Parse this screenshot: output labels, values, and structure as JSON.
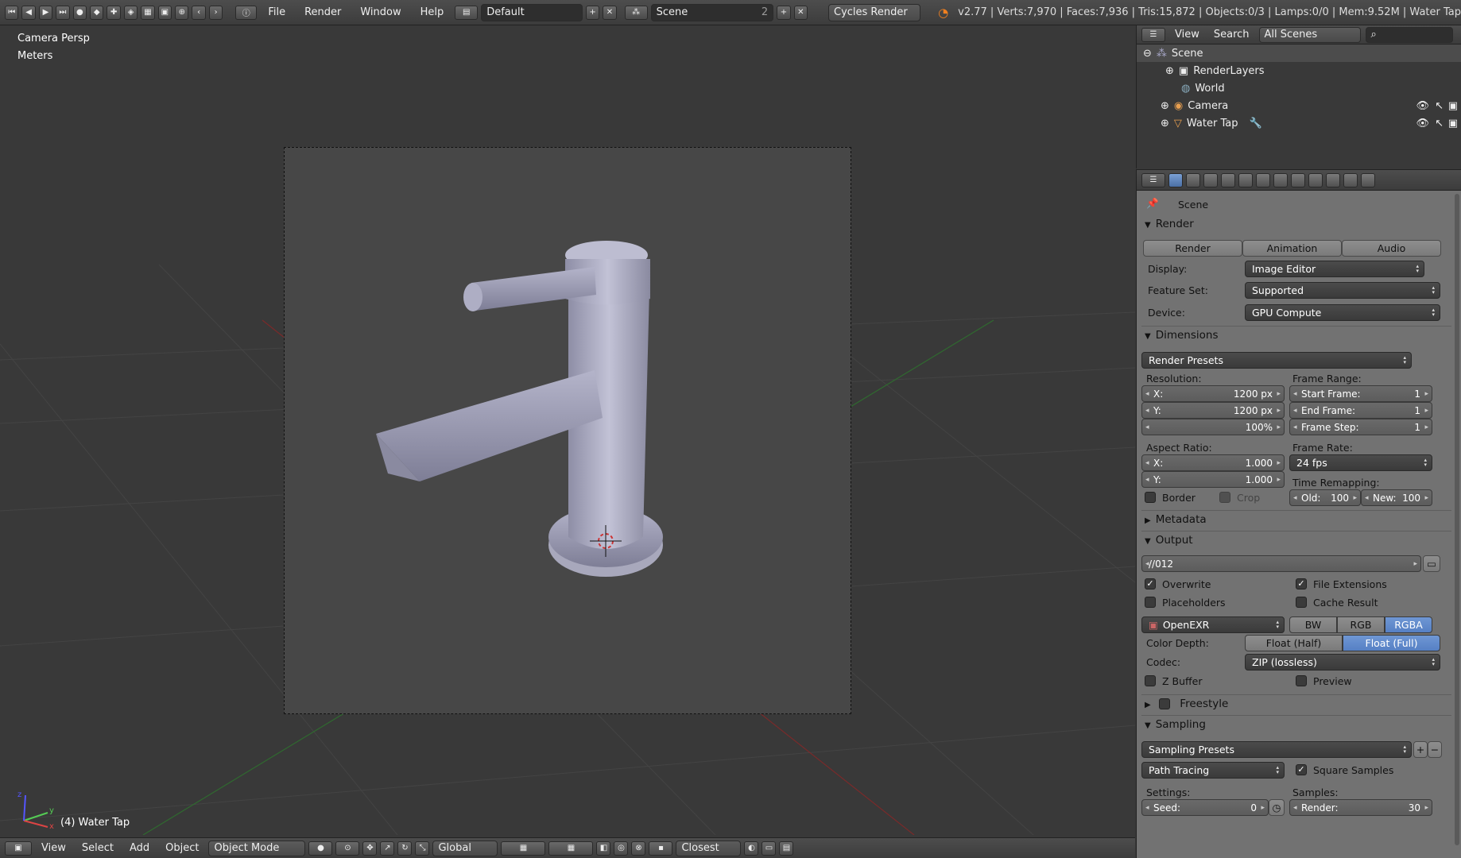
{
  "topbar": {
    "menus": [
      "File",
      "Render",
      "Window",
      "Help"
    ],
    "screen_layout": "Default",
    "scene": "Scene",
    "scene_users": "2",
    "render_engine": "Cycles Render",
    "stats": "v2.77 | Verts:7,970 | Faces:7,936 | Tris:15,872 | Objects:0/3 | Lamps:0/0 | Mem:9.52M | Water Tap"
  },
  "viewport": {
    "view_name": "Camera Persp",
    "units": "Meters",
    "active_object": "(4) Water Tap",
    "axis_x": "x",
    "axis_y": "y",
    "axis_z": "z"
  },
  "bottombar": {
    "menus": [
      "View",
      "Select",
      "Add",
      "Object"
    ],
    "mode": "Object Mode",
    "orientation": "Global",
    "snap_target": "Closest"
  },
  "outliner": {
    "menus": [
      "View",
      "Search"
    ],
    "display_mode": "All Scenes",
    "items": [
      {
        "label": "Scene"
      },
      {
        "label": "RenderLayers"
      },
      {
        "label": "World"
      },
      {
        "label": "Camera"
      },
      {
        "label": "Water Tap"
      }
    ]
  },
  "properties": {
    "context": "Scene",
    "render": {
      "title": "Render",
      "buttons": [
        "Render",
        "Animation",
        "Audio"
      ],
      "display_label": "Display:",
      "display_value": "Image Editor",
      "feature_label": "Feature Set:",
      "feature_value": "Supported",
      "device_label": "Device:",
      "device_value": "GPU Compute"
    },
    "dimensions": {
      "title": "Dimensions",
      "presets": "Render Presets",
      "resolution_label": "Resolution:",
      "res_x_label": "X:",
      "res_x": "1200 px",
      "res_y_label": "Y:",
      "res_y": "1200 px",
      "res_percent": "100%",
      "frame_range_label": "Frame Range:",
      "start_label": "Start Frame:",
      "start": "1",
      "end_label": "End Frame:",
      "end": "1",
      "step_label": "Frame Step:",
      "step": "1",
      "aspect_label": "Aspect Ratio:",
      "asp_x_label": "X:",
      "asp_x": "1.000",
      "asp_y_label": "Y:",
      "asp_y": "1.000",
      "frame_rate_label": "Frame Rate:",
      "frame_rate": "24 fps",
      "time_remap_label": "Time Remapping:",
      "old_label": "Old:",
      "old": "100",
      "new_label": "New:",
      "new": "100",
      "border": "Border",
      "crop": "Crop"
    },
    "metadata": {
      "title": "Metadata"
    },
    "output": {
      "title": "Output",
      "path": "//012",
      "overwrite": "Overwrite",
      "file_extensions": "File Extensions",
      "placeholders": "Placeholders",
      "cache_result": "Cache Result",
      "format": "OpenEXR",
      "color_modes": [
        "BW",
        "RGB",
        "RGBA"
      ],
      "color_depth_label": "Color Depth:",
      "depths": [
        "Float (Half)",
        "Float (Full)"
      ],
      "codec_label": "Codec:",
      "codec": "ZIP (lossless)",
      "zbuffer": "Z Buffer",
      "preview": "Preview"
    },
    "freestyle": {
      "title": "Freestyle"
    },
    "sampling": {
      "title": "Sampling",
      "presets": "Sampling Presets",
      "integrator": "Path Tracing",
      "square_samples": "Square Samples",
      "settings_label": "Settings:",
      "samples_label": "Samples:",
      "seed_label": "Seed:",
      "seed": "0",
      "render_label": "Render:",
      "render": "30"
    }
  },
  "colors": {
    "accent": "#5680c4",
    "panel": "#727272",
    "viewport": "#393939"
  }
}
